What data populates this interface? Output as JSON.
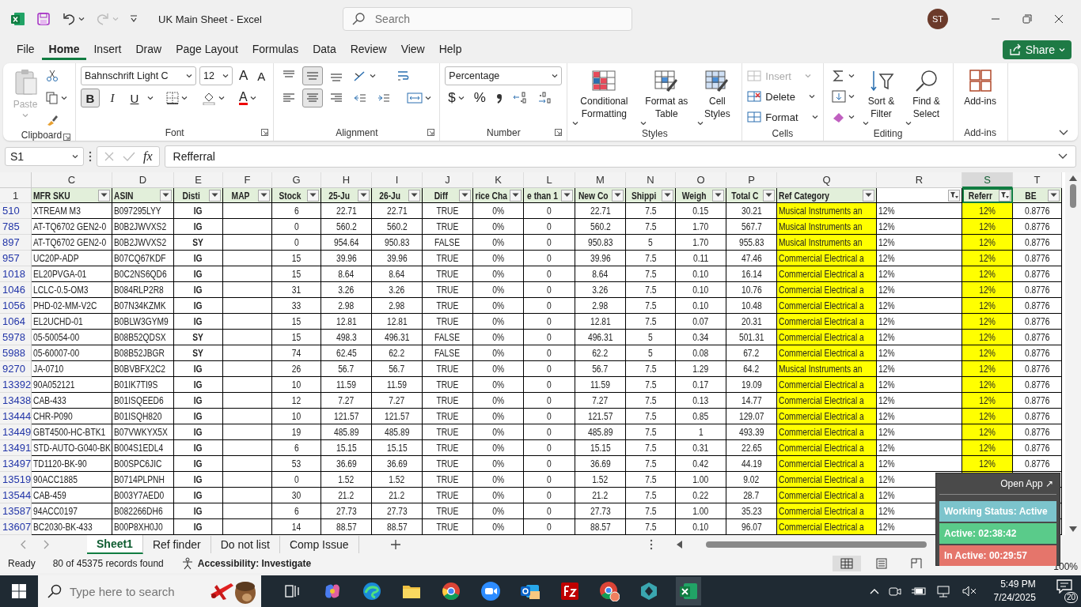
{
  "title_bar": {
    "title": "UK Main Sheet  -  Excel",
    "search": {
      "placeholder": "Search"
    },
    "avatar": "ST"
  },
  "menu": [
    {
      "label": "File",
      "selected": false
    },
    {
      "label": "Home",
      "selected": true
    },
    {
      "label": "Insert",
      "selected": false
    },
    {
      "label": "Draw",
      "selected": false
    },
    {
      "label": "Page Layout",
      "selected": false
    },
    {
      "label": "Formulas",
      "selected": false
    },
    {
      "label": "Data",
      "selected": false
    },
    {
      "label": "Review",
      "selected": false
    },
    {
      "label": "View",
      "selected": false
    },
    {
      "label": "Help",
      "selected": false
    }
  ],
  "share": "Share",
  "ribbon": [
    {
      "label": "Clipboard",
      "paste": {
        "label": "Paste",
        "disabled": true
      }
    },
    {
      "label": "Font",
      "font_name": "Bahnschrift Light C",
      "font_size": "12",
      "grow": "A",
      "shrink": "A",
      "styles": [
        {
          "label": "B",
          "on": true
        },
        {
          "label": "I",
          "on": false
        },
        {
          "label": "U",
          "on": false
        }
      ],
      "font_color": "A"
    },
    {
      "label": "Alignment",
      "vertical": [
        {
          "on": false
        },
        {
          "on": true
        },
        {
          "on": false
        }
      ],
      "horizontal": [
        {
          "on": false
        },
        {
          "on": true
        },
        {
          "on": false
        }
      ]
    },
    {
      "label": "Number",
      "format": "Percentage",
      "currency": "$",
      "percent": "%"
    },
    {
      "label": "Styles",
      "buttons": [
        "Conditional Formatting",
        "Format as Table",
        "Cell Styles"
      ]
    },
    {
      "label": "Cells",
      "buttons": [
        {
          "label": "Insert",
          "disabled": true
        },
        {
          "label": "Delete",
          "disabled": false
        },
        {
          "label": "Format",
          "disabled": false
        }
      ]
    },
    {
      "label": "Editing",
      "buttons": [
        "Sort & Filter",
        "Find & Select"
      ]
    },
    {
      "label": "Add-ins",
      "buttons": [
        "Add-ins"
      ]
    }
  ],
  "formula_bar": {
    "name_box": "S1",
    "fx": "fx",
    "content": "Refferral"
  },
  "sheet": {
    "header_row": "1",
    "columns": [
      {
        "letter": "C",
        "header": "MFR SKU",
        "kind": "text",
        "filtered": false,
        "highlight": false,
        "selected": false
      },
      {
        "letter": "D",
        "header": "ASIN",
        "kind": "text",
        "filtered": false,
        "highlight": false,
        "selected": false
      },
      {
        "letter": "E",
        "header": "Disti",
        "kind": "code",
        "filtered": false,
        "highlight": false,
        "selected": false
      },
      {
        "letter": "F",
        "header": "MAP",
        "kind": "number",
        "filtered": false,
        "highlight": false,
        "selected": false
      },
      {
        "letter": "G",
        "header": "Stock",
        "kind": "number",
        "filtered": false,
        "highlight": false,
        "selected": false
      },
      {
        "letter": "H",
        "header": "25-Ju",
        "kind": "number",
        "filtered": false,
        "highlight": false,
        "selected": false
      },
      {
        "letter": "I",
        "header": "26-Ju",
        "kind": "number",
        "filtered": false,
        "highlight": false,
        "selected": false
      },
      {
        "letter": "J",
        "header": "Diff",
        "kind": "number",
        "filtered": false,
        "highlight": false,
        "selected": false
      },
      {
        "letter": "K",
        "header": "rice Cha",
        "kind": "number",
        "filtered": false,
        "highlight": false,
        "selected": false
      },
      {
        "letter": "L",
        "header": "e than 1",
        "kind": "number",
        "filtered": false,
        "highlight": false,
        "selected": false
      },
      {
        "letter": "M",
        "header": "New Co",
        "kind": "number",
        "filtered": false,
        "highlight": false,
        "selected": false
      },
      {
        "letter": "N",
        "header": "Shippi",
        "kind": "number",
        "filtered": false,
        "highlight": false,
        "selected": false
      },
      {
        "letter": "O",
        "header": "Weigh",
        "kind": "number",
        "filtered": false,
        "highlight": false,
        "selected": false
      },
      {
        "letter": "P",
        "header": "Total C",
        "kind": "number",
        "filtered": false,
        "highlight": false,
        "selected": false
      },
      {
        "letter": "Q",
        "header": "Ref Category",
        "kind": "text",
        "filtered": false,
        "highlight": true,
        "selected": false
      },
      {
        "letter": "R",
        "kind": "text",
        "filtered": true,
        "highlight": false,
        "selected": false
      },
      {
        "letter": "S",
        "header": "Referr",
        "kind": "number",
        "filtered": true,
        "highlight": true,
        "selected": true
      },
      {
        "letter": "T",
        "header": "BE",
        "kind": "number",
        "filtered": false,
        "highlight": false,
        "selected": false
      }
    ],
    "rows": [
      {
        "number": "510",
        "cells": [
          "XTREAM M3",
          "B097295LYY",
          "IG",
          null,
          "6",
          "22.71",
          "22.71",
          "TRUE",
          "0%",
          "0",
          "22.71",
          "7.5",
          "0.15",
          "30.21",
          "Musical Instruments an",
          "12%",
          "12%",
          "0.8776"
        ]
      },
      {
        "number": "785",
        "cells": [
          "AT-TQ6702 GEN2-0",
          "B0B2JWVXS2",
          "IG",
          null,
          "0",
          "560.2",
          "560.2",
          "TRUE",
          "0%",
          "0",
          "560.2",
          "7.5",
          "1.70",
          "567.7",
          "Musical Instruments an",
          "12%",
          "12%",
          "0.8776"
        ]
      },
      {
        "number": "897",
        "cells": [
          "AT-TQ6702 GEN2-0",
          "B0B2JWVXS2",
          "SY",
          null,
          "0",
          "954.64",
          "950.83",
          "FALSE",
          "0%",
          "0",
          "950.83",
          "5",
          "1.70",
          "955.83",
          "Musical Instruments an",
          "12%",
          "12%",
          "0.8776"
        ]
      },
      {
        "number": "957",
        "cells": [
          "UC20P-ADP",
          "B07CQ67KDF",
          "IG",
          null,
          "15",
          "39.96",
          "39.96",
          "TRUE",
          "0%",
          "0",
          "39.96",
          "7.5",
          "0.11",
          "47.46",
          "Commercial Electrical a",
          "12%",
          "12%",
          "0.8776"
        ]
      },
      {
        "number": "1018",
        "cells": [
          "EL20PVGA-01",
          "B0C2NS6QD6",
          "IG",
          null,
          "15",
          "8.64",
          "8.64",
          "TRUE",
          "0%",
          "0",
          "8.64",
          "7.5",
          "0.10",
          "16.14",
          "Commercial Electrical a",
          "12%",
          "12%",
          "0.8776"
        ]
      },
      {
        "number": "1046",
        "cells": [
          "LCLC-0.5-OM3",
          "B084RLP2R8",
          "IG",
          null,
          "31",
          "3.26",
          "3.26",
          "TRUE",
          "0%",
          "0",
          "3.26",
          "7.5",
          "0.10",
          "10.76",
          "Commercial Electrical a",
          "12%",
          "12%",
          "0.8776"
        ]
      },
      {
        "number": "1056",
        "cells": [
          "PHD-02-MM-V2C",
          "B07N34KZMK",
          "IG",
          null,
          "33",
          "2.98",
          "2.98",
          "TRUE",
          "0%",
          "0",
          "2.98",
          "7.5",
          "0.10",
          "10.48",
          "Commercial Electrical a",
          "12%",
          "12%",
          "0.8776"
        ]
      },
      {
        "number": "1064",
        "cells": [
          "EL2UCHD-01",
          "B0BLW3GYM9",
          "IG",
          null,
          "15",
          "12.81",
          "12.81",
          "TRUE",
          "0%",
          "0",
          "12.81",
          "7.5",
          "0.07",
          "20.31",
          "Commercial Electrical a",
          "12%",
          "12%",
          "0.8776"
        ]
      },
      {
        "number": "5978",
        "cells": [
          "05-50054-00",
          "B08B52QDSX",
          "SY",
          null,
          "15",
          "498.3",
          "496.31",
          "FALSE",
          "0%",
          "0",
          "496.31",
          "5",
          "0.34",
          "501.31",
          "Commercial Electrical a",
          "12%",
          "12%",
          "0.8776"
        ]
      },
      {
        "number": "5988",
        "cells": [
          "05-60007-00",
          "B08B52JBGR",
          "SY",
          null,
          "74",
          "62.45",
          "62.2",
          "FALSE",
          "0%",
          "0",
          "62.2",
          "5",
          "0.08",
          "67.2",
          "Commercial Electrical a",
          "12%",
          "12%",
          "0.8776"
        ]
      },
      {
        "number": "9270",
        "cells": [
          "JA-0710",
          "B0BVBFX2C2",
          "IG",
          null,
          "26",
          "56.7",
          "56.7",
          "TRUE",
          "0%",
          "0",
          "56.7",
          "7.5",
          "1.29",
          "64.2",
          "Musical Instruments an",
          "12%",
          "12%",
          "0.8776"
        ]
      },
      {
        "number": "13392",
        "cells": [
          "90A052121",
          "B01IK7TI9S",
          "IG",
          null,
          "10",
          "11.59",
          "11.59",
          "TRUE",
          "0%",
          "0",
          "11.59",
          "7.5",
          "0.17",
          "19.09",
          "Commercial Electrical a",
          "12%",
          "12%",
          "0.8776"
        ]
      },
      {
        "number": "13438",
        "cells": [
          "CAB-433",
          "B01ISQEED6",
          "IG",
          null,
          "12",
          "7.27",
          "7.27",
          "TRUE",
          "0%",
          "0",
          "7.27",
          "7.5",
          "0.13",
          "14.77",
          "Commercial Electrical a",
          "12%",
          "12%",
          "0.8776"
        ]
      },
      {
        "number": "13444",
        "cells": [
          "CHR-P090",
          "B01ISQH820",
          "IG",
          null,
          "10",
          "121.57",
          "121.57",
          "TRUE",
          "0%",
          "0",
          "121.57",
          "7.5",
          "0.85",
          "129.07",
          "Commercial Electrical a",
          "12%",
          "12%",
          "0.8776"
        ]
      },
      {
        "number": "13449",
        "cells": [
          "GBT4500-HC-BTK1",
          "B07VWKYX5X",
          "IG",
          null,
          "19",
          "485.89",
          "485.89",
          "TRUE",
          "0%",
          "0",
          "485.89",
          "7.5",
          "1",
          "493.39",
          "Commercial Electrical a",
          "12%",
          "12%",
          "0.8776"
        ]
      },
      {
        "number": "13491",
        "cells": [
          "STD-AUTO-G040-BK",
          "B004S1EDL4",
          "IG",
          null,
          "6",
          "15.15",
          "15.15",
          "TRUE",
          "0%",
          "0",
          "15.15",
          "7.5",
          "0.31",
          "22.65",
          "Commercial Electrical a",
          "12%",
          "12%",
          "0.8776"
        ]
      },
      {
        "number": "13497",
        "cells": [
          "TD1120-BK-90",
          "B00SPC6JIC",
          "IG",
          null,
          "53",
          "36.69",
          "36.69",
          "TRUE",
          "0%",
          "0",
          "36.69",
          "7.5",
          "0.42",
          "44.19",
          "Commercial Electrical a",
          "12%",
          "12%",
          "0.8776"
        ]
      },
      {
        "number": "13519",
        "cells": [
          "90ACC1885",
          "B0714PLPNH",
          "IG",
          null,
          "0",
          "1.52",
          "1.52",
          "TRUE",
          "0%",
          "0",
          "1.52",
          "7.5",
          "1.00",
          "9.02",
          "Commercial Electrical a",
          "12%",
          null,
          null
        ]
      },
      {
        "number": "13544",
        "cells": [
          "CAB-459",
          "B003Y7AED0",
          "IG",
          null,
          "30",
          "21.2",
          "21.2",
          "TRUE",
          "0%",
          "0",
          "21.2",
          "7.5",
          "0.22",
          "28.7",
          "Commercial Electrical a",
          "12%",
          null,
          null
        ]
      },
      {
        "number": "13587",
        "cells": [
          "94ACC0197",
          "B082266DH6",
          "IG",
          null,
          "6",
          "27.73",
          "27.73",
          "TRUE",
          "0%",
          "0",
          "27.73",
          "7.5",
          "1.00",
          "35.23",
          "Commercial Electrical a",
          "12%",
          null,
          null
        ]
      },
      {
        "number": "13607",
        "cells": [
          "BC2030-BK-433",
          "B00P8XH0J0",
          "IG",
          null,
          "14",
          "88.57",
          "88.57",
          "TRUE",
          "0%",
          "0",
          "88.57",
          "7.5",
          "0.10",
          "96.07",
          "Commercial Electrical a",
          "12%",
          null,
          null
        ]
      }
    ]
  },
  "sheet_tabs": [
    {
      "label": "Sheet1",
      "selected": true
    },
    {
      "label": "Ref finder",
      "selected": false
    },
    {
      "label": "Do not list",
      "selected": false
    },
    {
      "label": "Comp Issue",
      "selected": false
    }
  ],
  "status_bar": {
    "ready": "Ready",
    "records": "80 of 45375 records found",
    "accessibility": "Accessibility: Investigate",
    "views": [
      {
        "selected": true
      },
      {
        "selected": false
      },
      {
        "selected": false
      }
    ],
    "zoom": "100%"
  },
  "overlay": {
    "open_app": "Open App ↗",
    "items": [
      {
        "label": "Working Status: Active",
        "color": "#7cc4cc"
      },
      {
        "label": "Active: 02:38:42",
        "color": "#5acb8a"
      },
      {
        "label": "In Active: 00:29:57",
        "color": "#e5756b"
      }
    ]
  },
  "taskbar": {
    "search": {
      "placeholder": "Type here to search"
    },
    "time": "5:49 PM",
    "date": "7/24/2025",
    "notifications": "20"
  }
}
